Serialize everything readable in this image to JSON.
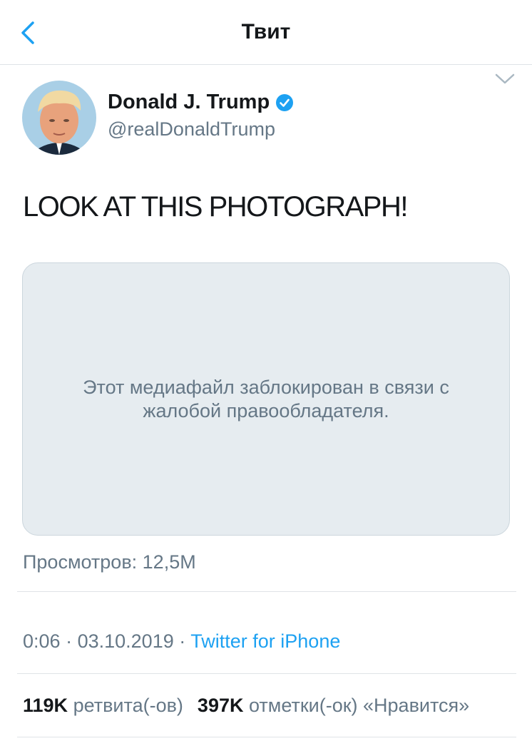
{
  "navbar": {
    "title": "Твит"
  },
  "tweet": {
    "author_name": "Donald J. Trump",
    "author_handle": "@realDonaldTrump",
    "text": "LOOK AT THIS PHOTOGRAPH!",
    "media_message": "Этот медиафайл заблокирован в связи с жалобой правообладателя.",
    "views": "Просмотров: 12,5M",
    "time": "0:06",
    "separator": "·",
    "date": "03.10.2019",
    "source": "Twitter for iPhone",
    "retweets_count": "119K",
    "retweets_label": "ретвита(-ов)",
    "likes_count": "397K",
    "likes_label": "отметки(-ок) «Нравится»"
  },
  "colors": {
    "accent": "#1da1f2",
    "secondary_text": "#657786",
    "media_bg": "#e6ecf0"
  },
  "icons": {
    "back": "chevron-left-icon",
    "menu": "chevron-down-icon",
    "verified": "verified-badge-icon"
  }
}
